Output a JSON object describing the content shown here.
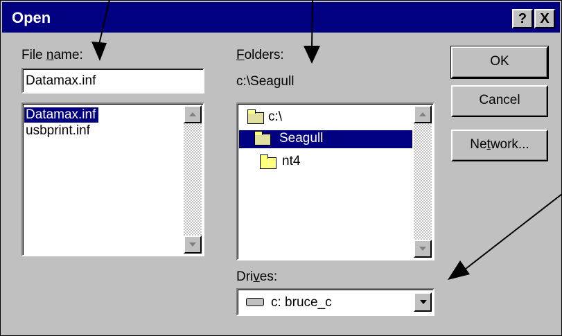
{
  "dialog": {
    "title": "Open",
    "help_button": "?",
    "close_button": "X"
  },
  "file_name": {
    "label_prefix": "File ",
    "label_accel": "n",
    "label_suffix": "ame:",
    "value": "Datamax.inf",
    "files": [
      "Datamax.inf",
      "usbprint.inf"
    ],
    "selected_index": 0
  },
  "folders": {
    "label_accel": "F",
    "label_suffix": "olders:",
    "current_path": "c:\\Seagull",
    "items": [
      "c:\\",
      "Seagull",
      "nt4"
    ],
    "selected_index": 1
  },
  "drives": {
    "label_prefix": "Dri",
    "label_accel": "v",
    "label_suffix": "es:",
    "selected": "c: bruce_c",
    "icon": "drive-icon"
  },
  "buttons": {
    "ok": "OK",
    "cancel": "Cancel",
    "network_prefix": "Ne",
    "network_accel": "t",
    "network_suffix": "work..."
  },
  "colors": {
    "titlebar": "#000080",
    "face": "#c0c0c0",
    "selection": "#000080"
  },
  "annotations": {
    "arrow_count": 3,
    "icon": "arrow-icon"
  }
}
